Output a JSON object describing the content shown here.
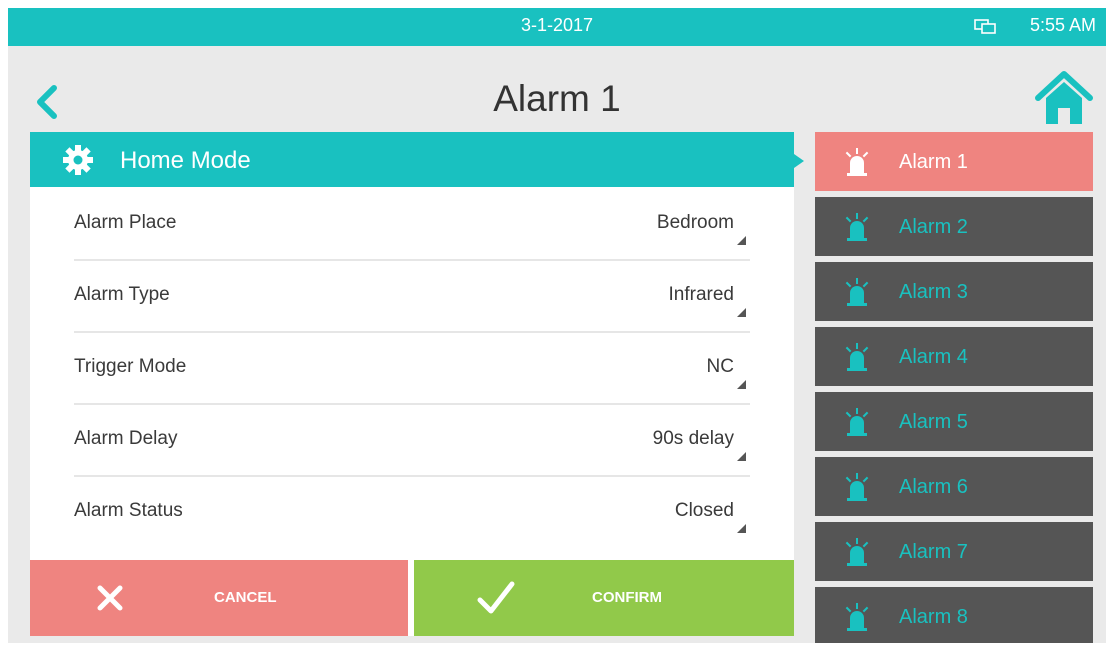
{
  "status_bar": {
    "date": "3-1-2017",
    "time": "5:55 AM",
    "network_icon": "network-icon"
  },
  "header": {
    "title": "Alarm 1",
    "back_icon": "back-arrow-icon",
    "home_icon": "home-icon"
  },
  "mode": {
    "label": "Home Mode",
    "icon": "gear-icon"
  },
  "settings": [
    {
      "label": "Alarm Place",
      "value": "Bedroom"
    },
    {
      "label": "Alarm Type",
      "value": "Infrared"
    },
    {
      "label": "Trigger Mode",
      "value": "NC"
    },
    {
      "label": "Alarm Delay",
      "value": "90s delay"
    },
    {
      "label": "Alarm Status",
      "value": "Closed"
    }
  ],
  "buttons": {
    "cancel": "CANCEL",
    "confirm": "CONFIRM"
  },
  "alarms": [
    {
      "label": "Alarm 1",
      "active": true
    },
    {
      "label": "Alarm 2",
      "active": false
    },
    {
      "label": "Alarm 3",
      "active": false
    },
    {
      "label": "Alarm 4",
      "active": false
    },
    {
      "label": "Alarm 5",
      "active": false
    },
    {
      "label": "Alarm 6",
      "active": false
    },
    {
      "label": "Alarm 7",
      "active": false
    },
    {
      "label": "Alarm 8",
      "active": false
    }
  ],
  "colors": {
    "accent": "#19c1c0",
    "cancel": "#ef8480",
    "confirm": "#91c94a",
    "list_bg": "#555555",
    "active_item": "#ef8480"
  }
}
